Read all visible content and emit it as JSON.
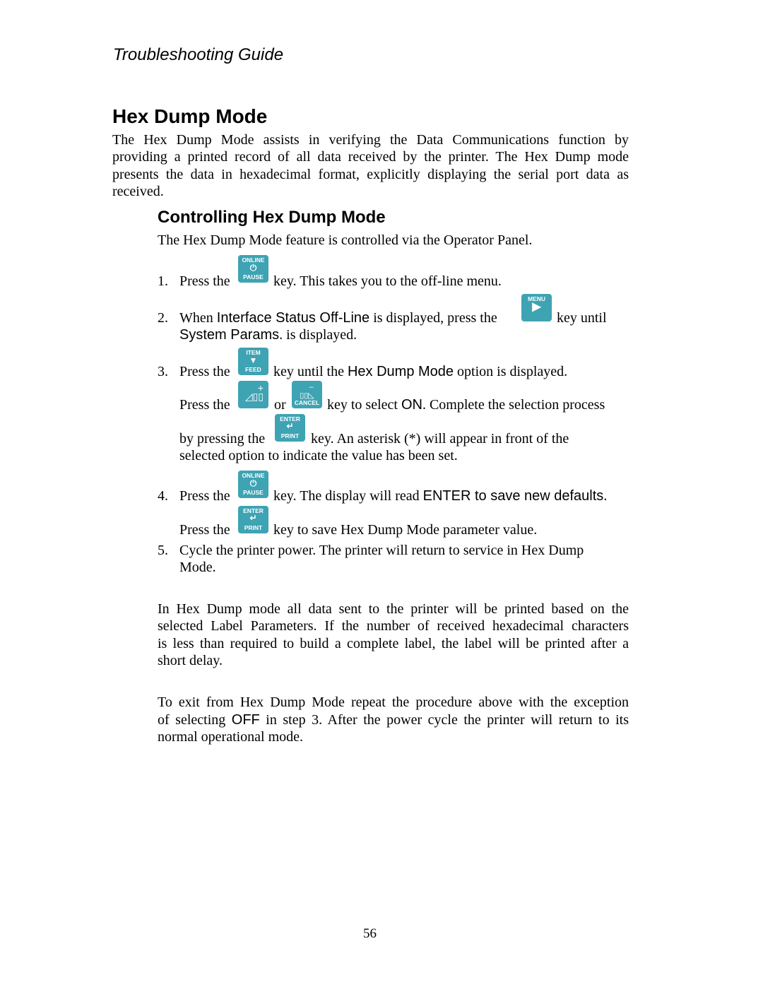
{
  "header": {
    "running_title": "Troubleshooting Guide"
  },
  "section": {
    "title": "Hex Dump Mode",
    "intro_lines": [
      "The Hex Dump Mode assists in verifying the Data Communications function by",
      "providing a printed record of all data received by the printer. The Hex Dump mode",
      "presents the data in hexadecimal format, explicitly displaying the serial port data as",
      "received."
    ]
  },
  "subsection": {
    "title": "Controlling Hex Dump Mode",
    "lead": "The Hex Dump Mode feature is controlled via the Operator Panel."
  },
  "keys": {
    "online_top": "ONLINE",
    "online_bottom": "PAUSE",
    "online_icon": "power-icon",
    "menu_top": "MENU",
    "menu_icon": "play-right-icon",
    "item_top": "ITEM",
    "item_bottom": "FEED",
    "item_icon": "triangle-down-icon",
    "plus_icon": "plus-signal-bars-icon",
    "cancel_bottom": "CANCEL",
    "cancel_icon": "minus-signal-bars-icon",
    "enter_top": "ENTER",
    "enter_bottom": "PRINT",
    "enter_icon": "return-arrow-icon",
    "color": "#3ea3b3"
  },
  "steps": {
    "s1": {
      "num": "1.",
      "a": "Press the",
      "b": "key. This takes you to the off-line menu."
    },
    "s2": {
      "num": "2.",
      "a": "When ",
      "ui1": "Interface Status Off-Line",
      "b": " is displayed, press the",
      "c": "key until",
      "ui2": "System Params",
      "d": ". is displayed."
    },
    "s3": {
      "num": "3.",
      "a": "Press the",
      "b": "key until the ",
      "ui1": "Hex Dump Mode",
      "c": " option is displayed.",
      "d": "Press the",
      "e": "or",
      "f": "key to select ",
      "ui2": "ON",
      "g": ". Complete the selection process",
      "h": "by pressing the",
      "i": "key. An asterisk (*) will appear in front of the",
      "j": "selected option to indicate the value has been set."
    },
    "s4": {
      "num": "4.",
      "a": "Press the",
      "b": "key. The display will read ",
      "ui1": "ENTER to save new defaults",
      "c": ".",
      "d": "Press the",
      "e": "key to save Hex Dump Mode parameter value."
    },
    "s5": {
      "num": "5.",
      "a": "Cycle the printer power. The printer will return to service in Hex Dump",
      "b": "Mode."
    }
  },
  "para1_lines": [
    "In Hex Dump mode all data sent to the printer will be printed based on the",
    "selected Label Parameters. If the number of received hexadecimal characters",
    "is less than required to build a complete label, the label will be printed after a",
    "short delay."
  ],
  "para2": {
    "l1": "To exit from Hex Dump Mode repeat the procedure above with the exception",
    "l2a": "of selecting ",
    "l2ui": "OFF",
    "l2b": " in step 3. After the power cycle the printer will return to its",
    "l3": "normal operational mode."
  },
  "footer": {
    "page_number": "56"
  }
}
